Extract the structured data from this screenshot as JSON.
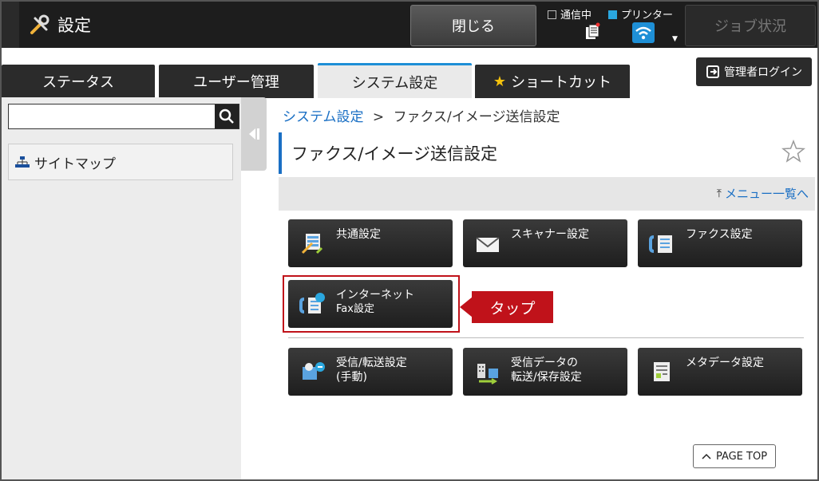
{
  "header": {
    "title": "設定",
    "close_label": "閉じる",
    "status_comm": "通信中",
    "status_printer": "プリンター",
    "job_status_label": "ジョブ状況"
  },
  "tabs": [
    {
      "label": "ステータス"
    },
    {
      "label": "ユーザー管理"
    },
    {
      "label": "システム設定"
    },
    {
      "label": "ショートカット"
    }
  ],
  "admin_login_label": "管理者ログイン",
  "sidebar": {
    "search_placeholder": "",
    "sitemap_label": "サイトマップ"
  },
  "breadcrumb": {
    "parent": "システム設定",
    "separator": ">",
    "current": "ファクス/イメージ送信設定"
  },
  "page_title": "ファクス/イメージ送信設定",
  "menu_list_link": "メニュー一覧へ",
  "tiles": [
    {
      "line1": "共通設定",
      "line2": ""
    },
    {
      "line1": "スキャナー設定",
      "line2": ""
    },
    {
      "line1": "ファクス設定",
      "line2": ""
    },
    {
      "line1": "インターネット",
      "line2": "Fax設定"
    },
    {
      "line1": "受信/転送設定",
      "line2": "(手動)"
    },
    {
      "line1": "受信データの",
      "line2": "転送/保存設定"
    },
    {
      "line1": "メタデータ設定",
      "line2": ""
    }
  ],
  "callout_label": "タップ",
  "page_top_label": "PAGE TOP",
  "colors": {
    "accent": "#1a6fc4",
    "highlight": "#c0121a",
    "wifi": "#1e8fd6"
  }
}
